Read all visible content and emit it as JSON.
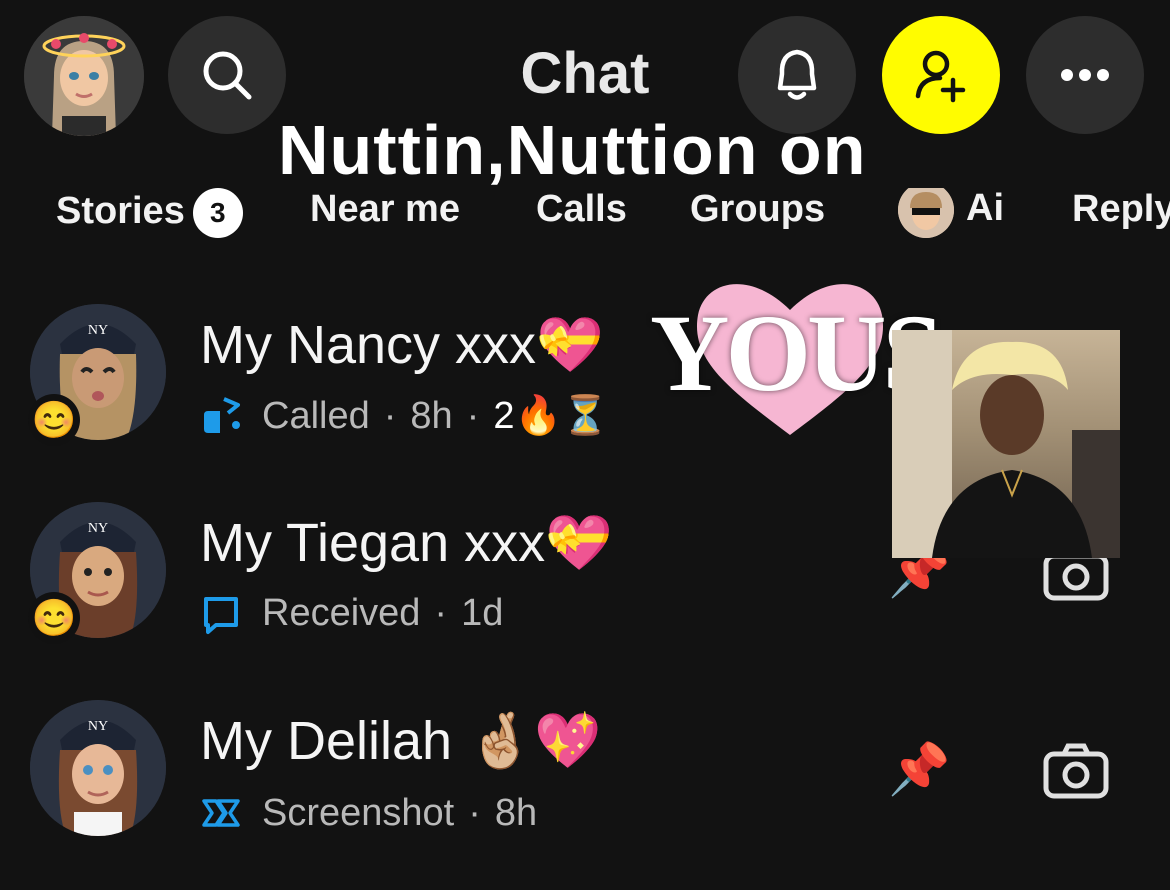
{
  "header": {
    "title": "Chat",
    "overlay_caption": "Nuttin,Nuttion  on"
  },
  "tabs": [
    {
      "label": "Stories",
      "badge": "3"
    },
    {
      "label": "Near me"
    },
    {
      "label": "Calls"
    },
    {
      "label": "Groups"
    },
    {
      "label": "Ai"
    },
    {
      "label": "Reply"
    }
  ],
  "chats": [
    {
      "name": "My Nancy xxx",
      "name_emoji": "💝",
      "status_icon": "call-icon",
      "status": "Called",
      "time": "8h",
      "streak": "2",
      "streak_emojis": "🔥⏳",
      "friend_emoji": "😊"
    },
    {
      "name": "My Tiegan xxx",
      "name_emoji": "💝",
      "status_icon": "chat-bubble-icon",
      "status": "Received",
      "time": "1d",
      "friend_emoji": "😊"
    },
    {
      "name": "My Delilah ",
      "name_emoji": "🤞🏼💖",
      "status_icon": "screenshot-icon",
      "status": "Screenshot",
      "time": "8h"
    }
  ],
  "overlays": {
    "sticker_text": "YOUS"
  },
  "colors": {
    "background": "#121212",
    "add_friend": "#FFFC00",
    "accent_blue": "#1E9BE9"
  }
}
